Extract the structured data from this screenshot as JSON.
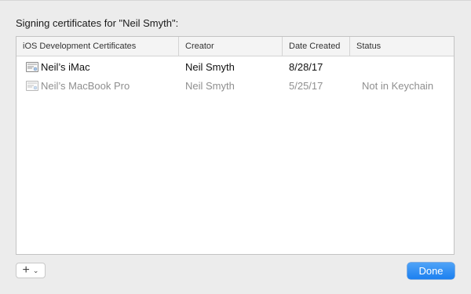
{
  "dialog": {
    "title": "Signing certificates for \"Neil Smyth\":"
  },
  "table": {
    "columns": [
      "iOS Development Certificates",
      "Creator",
      "Date Created",
      "Status"
    ],
    "rows": [
      {
        "name": "Neil’s iMac",
        "creator": "Neil Smyth",
        "date": "8/28/17",
        "status": "",
        "icon": "certificate-icon",
        "dimmed": false
      },
      {
        "name": "Neil’s MacBook Pro",
        "creator": "Neil Smyth",
        "date": "5/25/17",
        "status": "Not in Keychain",
        "icon": "certificate-icon",
        "dimmed": true
      }
    ]
  },
  "footer": {
    "add_symbol": "+",
    "menu_symbol": "⌄",
    "done_label": "Done"
  },
  "colors": {
    "accent": "#1c80f0",
    "dim_text": "#8f8f8f",
    "background": "#ececec"
  }
}
